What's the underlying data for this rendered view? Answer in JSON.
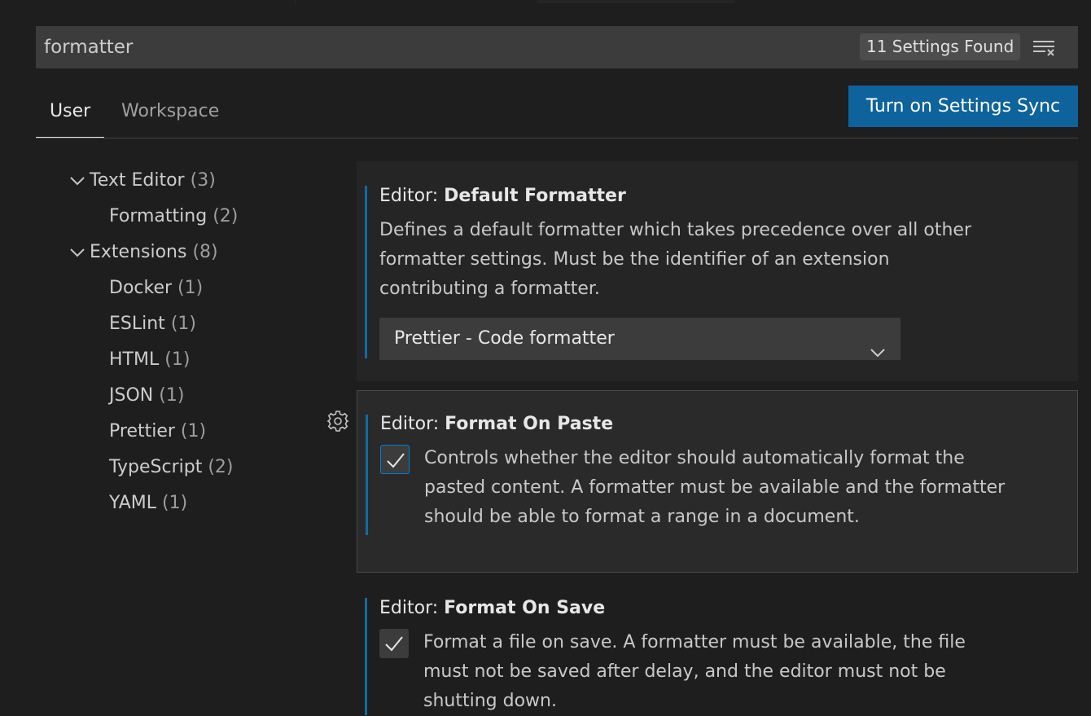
{
  "search": {
    "value": "formatter",
    "count_label": "11 Settings Found"
  },
  "tabs": [
    {
      "label": "User",
      "active": true
    },
    {
      "label": "Workspace",
      "active": false
    }
  ],
  "sync_button": "Turn on Settings Sync",
  "toc": [
    {
      "label": "Text Editor",
      "count": "(3)",
      "expandable": true
    },
    {
      "label": "Formatting",
      "count": "(2)",
      "expandable": false
    },
    {
      "label": "Extensions",
      "count": "(8)",
      "expandable": true
    },
    {
      "label": "Docker",
      "count": "(1)",
      "expandable": false
    },
    {
      "label": "ESLint",
      "count": "(1)",
      "expandable": false
    },
    {
      "label": "HTML",
      "count": "(1)",
      "expandable": false
    },
    {
      "label": "JSON",
      "count": "(1)",
      "expandable": false
    },
    {
      "label": "Prettier",
      "count": "(1)",
      "expandable": false
    },
    {
      "label": "TypeScript",
      "count": "(2)",
      "expandable": false
    },
    {
      "label": "YAML",
      "count": "(1)",
      "expandable": false
    }
  ],
  "settings": [
    {
      "category": "Editor: ",
      "name": "Default Formatter",
      "description_lines": [
        "Defines a default formatter which takes precedence over all other",
        "formatter settings. Must be the identifier of an extension",
        "contributing a formatter."
      ],
      "type": "select",
      "value": "Prettier - Code formatter"
    },
    {
      "category": "Editor: ",
      "name": "Format On Paste",
      "description_lines": [
        "Controls whether the editor should automatically format the",
        "pasted content. A formatter must be available and the formatter",
        "should be able to format a range in a document."
      ],
      "type": "checkbox",
      "checked": true
    },
    {
      "category": "Editor: ",
      "name": "Format On Save",
      "description_lines": [
        "Format a file on save. A formatter must be available, the file",
        "must not be saved after delay, and the editor must not be",
        "shutting down."
      ],
      "type": "checkbox",
      "checked": true
    }
  ],
  "colors": {
    "accent": "#0e639c",
    "modified_bar": "#0f6ca3",
    "focus_border": "#007fd4"
  }
}
